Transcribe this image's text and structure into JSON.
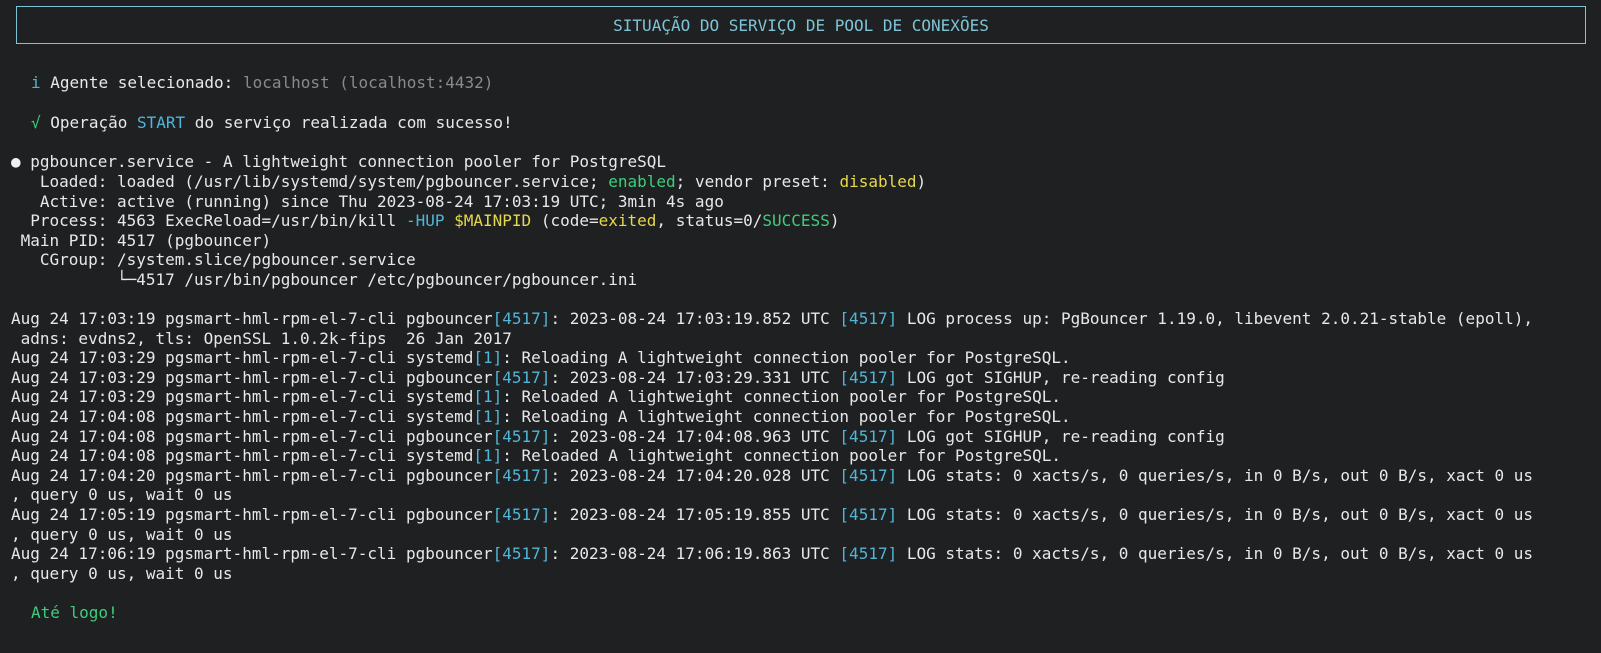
{
  "header": {
    "title": "SITUAÇÃO DO SERVIÇO DE POOL DE CONEXÕES"
  },
  "agent": {
    "icon": "i",
    "label": "Agente selecionado:",
    "value": "localhost (localhost:4432)"
  },
  "operation": {
    "icon": "√",
    "prefix": "Operação",
    "action": "START",
    "suffix": "do serviço realizada com sucesso!"
  },
  "status": {
    "bullet": "●",
    "title": "pgbouncer.service - A lightweight connection pooler for PostgreSQL",
    "loaded_label": "   Loaded:",
    "loaded_prefix": " loaded (/usr/lib/systemd/system/pgbouncer.service; ",
    "loaded_enabled": "enabled",
    "loaded_mid": "; vendor preset: ",
    "loaded_disabled": "disabled",
    "loaded_suffix": ")",
    "active_label": "   Active:",
    "active_value": " active (running) since Thu 2023-08-24 17:03:19 UTC; 3min 4s ago",
    "process_label": "  Process:",
    "process_prefix": " 4563 ExecReload=/usr/bin/kill ",
    "process_hup": "-HUP",
    "process_space": " ",
    "process_mainpid": "$MAINPID",
    "process_code": " (code=",
    "process_exited": "exited",
    "process_status": ", status=0/",
    "process_success": "SUCCESS",
    "process_end": ")",
    "mainpid_label": " Main PID:",
    "mainpid_value": " 4517 (pgbouncer)",
    "cgroup_label": "   CGroup:",
    "cgroup_value": " /system.slice/pgbouncer.service",
    "cgroup_child": "           └─4517 /usr/bin/pgbouncer /etc/pgbouncer/pgbouncer.ini"
  },
  "logs": [
    {
      "pre": "Aug 24 17:03:19 pgsmart-hml-rpm-el-7-cli pgbouncer",
      "pid": "[4517]",
      "mid": ": 2023-08-24 17:03:19.852 UTC ",
      "pid2": "[4517]",
      "post": " LOG process up: PgBouncer 1.19.0, libevent 2.0.21-stable (epoll),"
    },
    {
      "pre": " adns: evdns2, tls: OpenSSL 1.0.2k-fips  26 Jan 2017",
      "pid": "",
      "mid": "",
      "pid2": "",
      "post": ""
    },
    {
      "pre": "Aug 24 17:03:29 pgsmart-hml-rpm-el-7-cli systemd",
      "pid": "[1]",
      "mid": ": Reloading A lightweight connection pooler for PostgreSQL.",
      "pid2": "",
      "post": ""
    },
    {
      "pre": "Aug 24 17:03:29 pgsmart-hml-rpm-el-7-cli pgbouncer",
      "pid": "[4517]",
      "mid": ": 2023-08-24 17:03:29.331 UTC ",
      "pid2": "[4517]",
      "post": " LOG got SIGHUP, re-reading config"
    },
    {
      "pre": "Aug 24 17:03:29 pgsmart-hml-rpm-el-7-cli systemd",
      "pid": "[1]",
      "mid": ": Reloaded A lightweight connection pooler for PostgreSQL.",
      "pid2": "",
      "post": ""
    },
    {
      "pre": "Aug 24 17:04:08 pgsmart-hml-rpm-el-7-cli systemd",
      "pid": "[1]",
      "mid": ": Reloading A lightweight connection pooler for PostgreSQL.",
      "pid2": "",
      "post": ""
    },
    {
      "pre": "Aug 24 17:04:08 pgsmart-hml-rpm-el-7-cli pgbouncer",
      "pid": "[4517]",
      "mid": ": 2023-08-24 17:04:08.963 UTC ",
      "pid2": "[4517]",
      "post": " LOG got SIGHUP, re-reading config"
    },
    {
      "pre": "Aug 24 17:04:08 pgsmart-hml-rpm-el-7-cli systemd",
      "pid": "[1]",
      "mid": ": Reloaded A lightweight connection pooler for PostgreSQL.",
      "pid2": "",
      "post": ""
    },
    {
      "pre": "Aug 24 17:04:20 pgsmart-hml-rpm-el-7-cli pgbouncer",
      "pid": "[4517]",
      "mid": ": 2023-08-24 17:04:20.028 UTC ",
      "pid2": "[4517]",
      "post": " LOG stats: 0 xacts/s, 0 queries/s, in 0 B/s, out 0 B/s, xact 0 us"
    },
    {
      "pre": ", query 0 us, wait 0 us",
      "pid": "",
      "mid": "",
      "pid2": "",
      "post": ""
    },
    {
      "pre": "Aug 24 17:05:19 pgsmart-hml-rpm-el-7-cli pgbouncer",
      "pid": "[4517]",
      "mid": ": 2023-08-24 17:05:19.855 UTC ",
      "pid2": "[4517]",
      "post": " LOG stats: 0 xacts/s, 0 queries/s, in 0 B/s, out 0 B/s, xact 0 us"
    },
    {
      "pre": ", query 0 us, wait 0 us",
      "pid": "",
      "mid": "",
      "pid2": "",
      "post": ""
    },
    {
      "pre": "Aug 24 17:06:19 pgsmart-hml-rpm-el-7-cli pgbouncer",
      "pid": "[4517]",
      "mid": ": 2023-08-24 17:06:19.863 UTC ",
      "pid2": "[4517]",
      "post": " LOG stats: 0 xacts/s, 0 queries/s, in 0 B/s, out 0 B/s, xact 0 us"
    },
    {
      "pre": ", query 0 us, wait 0 us",
      "pid": "",
      "mid": "",
      "pid2": "",
      "post": ""
    }
  ],
  "farewell": "Até logo!"
}
